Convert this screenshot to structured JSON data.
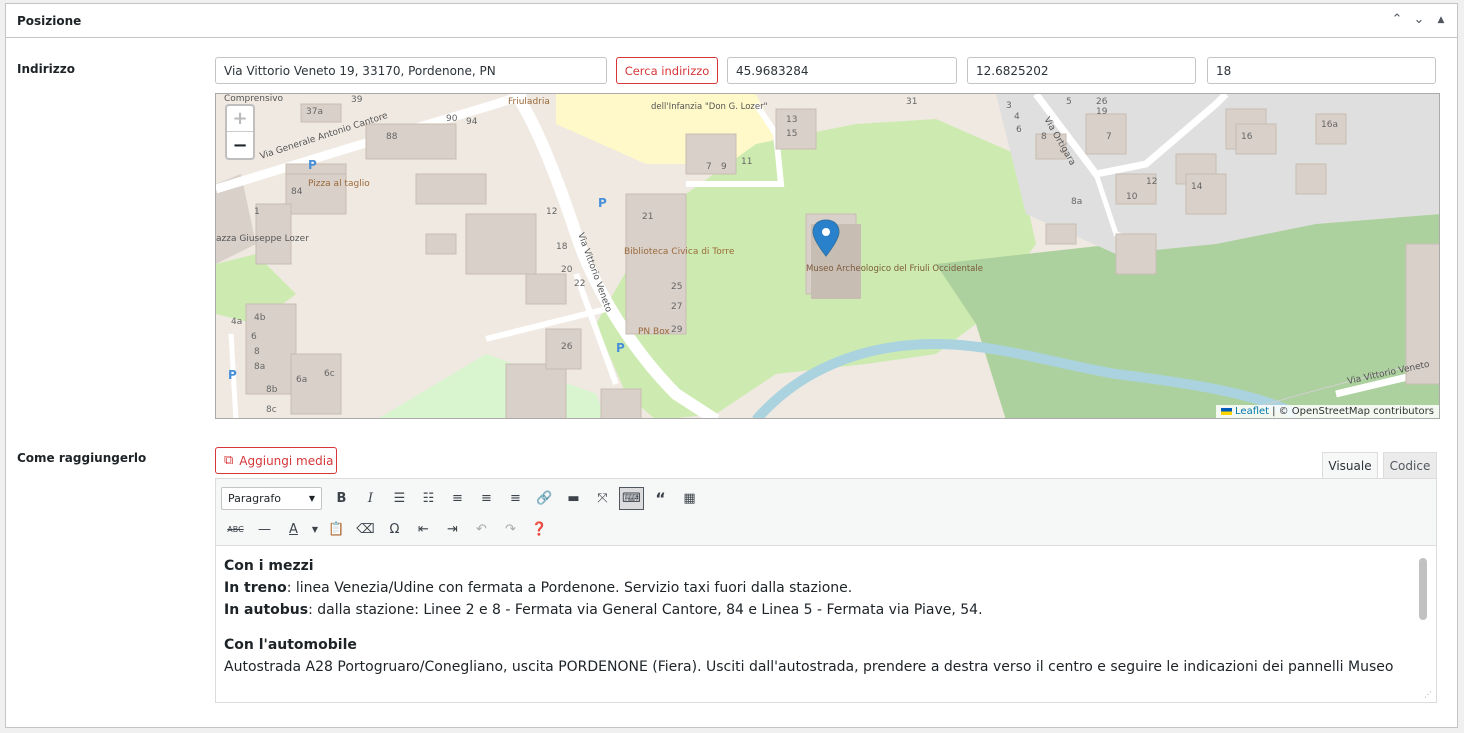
{
  "panel": {
    "title": "Posizione",
    "up": "^",
    "down": "v",
    "toggle": "▲"
  },
  "address": {
    "label": "Indirizzo",
    "street": "Via Vittorio Veneto 19, 33170, Pordenone, PN",
    "search_button": "Cerca indirizzo",
    "lat": "45.9683284",
    "lng": "12.6825202",
    "zoom": "18"
  },
  "map": {
    "zoom_in": "+",
    "zoom_out": "−",
    "attribution_leaflet": "Leaflet",
    "attribution_osm": "| © OpenStreetMap contributors",
    "labels": {
      "comprensivo": "Comprensivo",
      "cantore": "Via Generale Antonio Cantore",
      "pizza": "Pizza al taglio",
      "friuladria": "Friuladria",
      "infanzia": "dell'Infanzia \"Don G. Lozer\"",
      "biblioteca": "Biblioteca Civica di Torre",
      "vittorio_veneto": "Via Vittorio Veneto",
      "museo": "Museo Archeologico del Friuli Occidentale",
      "ortigara": "Via Ortigara",
      "pnbox": "PN Box",
      "piazza": "azza Giuseppe Lozer",
      "vv2": "Via Vittorio Veneto"
    }
  },
  "route": {
    "label": "Come raggiungerlo",
    "media_button": "Aggiungi media",
    "tab_visual": "Visuale",
    "tab_code": "Codice",
    "format": "Paragrafo",
    "h1": "Con i mezzi",
    "train_b": "In treno",
    "train_t": ": linea Venezia/Udine con fermata a Pordenone. Servizio taxi fuori dalla stazione.",
    "bus_b": "In autobus",
    "bus_t": ": dalla stazione: Linee 2 e 8 - Fermata via General Cantore, 84 e Linea 5 - Fermata via Piave, 54.",
    "h2": "Con l'automobile",
    "car_t": "Autostrada A28 Portogruaro/Conegliano, uscita PORDENONE (Fiera). Usciti dall'autostrada, prendere a destra verso il centro e seguire le indicazioni dei pannelli Museo"
  },
  "colors": {
    "accent": "#d63638",
    "park": "#cdebb0",
    "forest": "#add19e",
    "water": "#aad3df"
  }
}
